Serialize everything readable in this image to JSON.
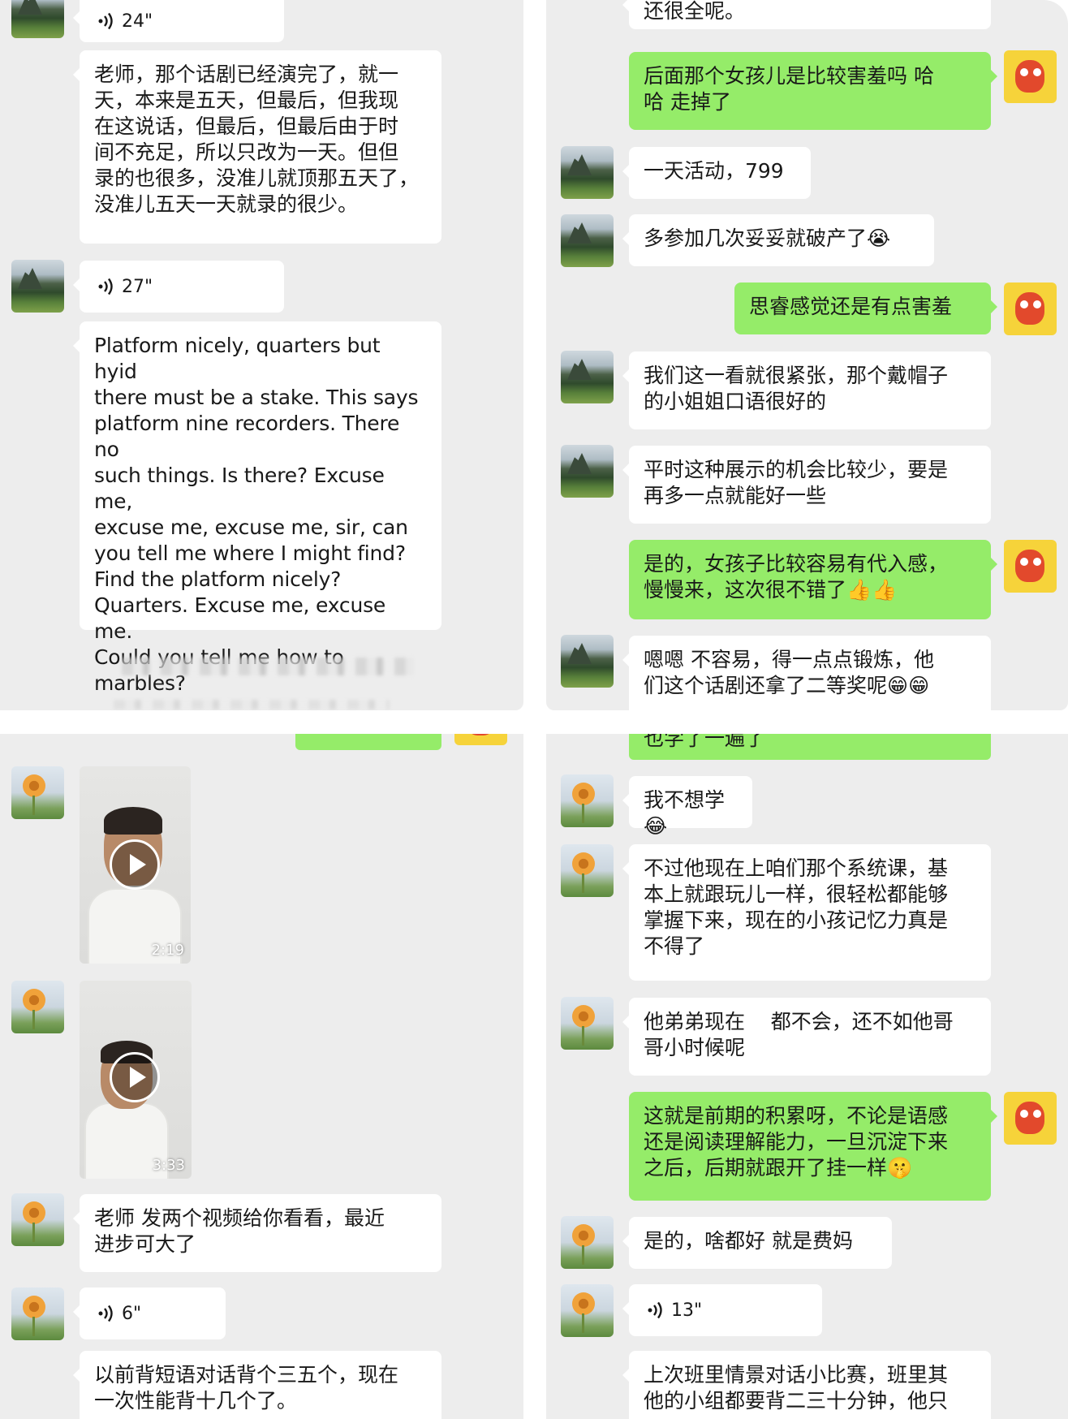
{
  "panels": {
    "top_left": {
      "voice_1": "24\"",
      "msg_1": "老师，那个话剧已经演完了，就一\n天，本来是五天，但最后，但我现\n在这说话，但最后，但最后由于时\n间不充足，所以只改为一天。但但\n录的也很多，没准儿就顶那五天了，\n没准儿五天一天就录的很少。",
      "voice_2": "27\"",
      "msg_2": "Platform nicely, quarters but hyid\nthere must be a stake. This says\nplatform nine recorders. There no\nsuch things. Is there? Excuse me,\nexcuse me, excuse me, sir, can\nyou tell me where I might find?\nFind the platform nicely?\nQuarters. Excuse me, excuse me.\nCould you tell me how to\nmarbles?"
    },
    "top_right": {
      "fragment_top": "还很全呢。",
      "out_1": "后面那个女孩儿是比较害羞吗 哈\n哈 走掉了",
      "in_1": "一天活动，799",
      "in_2": "多参加几次妥妥就破产了😭",
      "out_2": "思睿感觉还是有点害羞",
      "in_3": "我们这一看就很紧张，那个戴帽子\n的小姐姐口语很好的",
      "in_4": "平时这种展示的机会比较少，要是\n再多一点就能好一些",
      "out_3": "是的，女孩子比较容易有代入感，\n慢慢来，这次很不错了👍👍",
      "in_5": "嗯嗯 不容易，得一点点锻炼，他\n们这个话剧还拿了二等奖呢😁😁"
    },
    "bottom_left": {
      "video_1_duration": "2:19",
      "video_2_duration": "3:33",
      "msg_1": "老师 发两个视频给你看看，最近\n进步可大了",
      "voice_1": "6\"",
      "msg_2": "以前背短语对话背个三五个，现在\n一次性能背十几个了。"
    },
    "bottom_right": {
      "fragment_top": "也学了一遍了",
      "in_1": "我不想学😂",
      "in_2": "不过他现在上咱们那个系统课，基\n本上就跟玩儿一样，很轻松都能够\n掌握下来，现在的小孩记忆力真是\n不得了",
      "in_3": "他弟弟现在    都不会，还不如他哥\n哥小时候呢",
      "out_1": "这就是前期的积累呀，不论是语感\n还是阅读理解能力，一旦沉淀下来\n之后，后期就跟开了挂一样🤫",
      "in_4": "是的，啥都好 就是费妈",
      "voice_1": "13\"",
      "in_5": "上次班里情景对话小比赛，班里其\n他的小组都要背二三十分钟，他只"
    }
  },
  "colors": {
    "background": "#ededed",
    "bubble_in": "#ffffff",
    "bubble_out": "#95ec69",
    "text": "#191919"
  },
  "icons": [
    "voice-wave-icon",
    "play-icon",
    "mountain-avatar",
    "flower-avatar",
    "owl-avatar"
  ]
}
